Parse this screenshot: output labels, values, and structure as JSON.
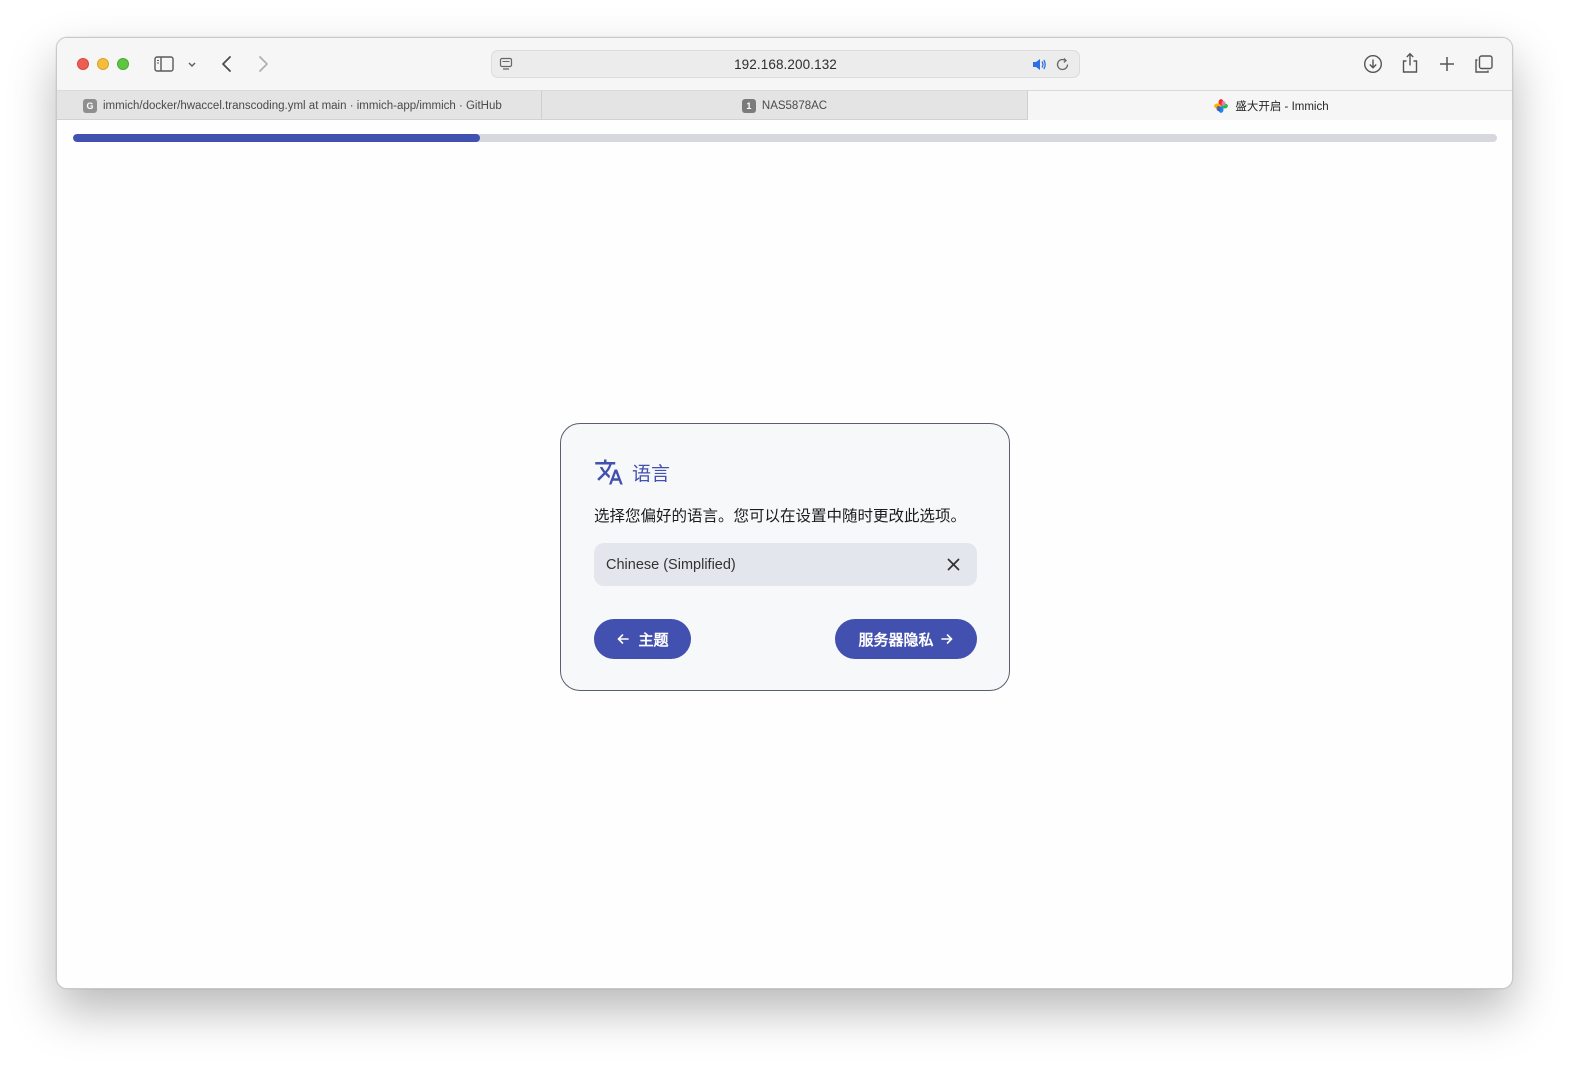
{
  "browser": {
    "address": "192.168.200.132",
    "tabs": [
      {
        "label": "immich/docker/hwaccel.transcoding.yml at main · immich-app/immich · GitHub",
        "favicon": "G"
      },
      {
        "label": "NAS5878AC",
        "favicon": "1"
      },
      {
        "label": "盛大开启 - Immich",
        "favicon": "immich-logo"
      }
    ]
  },
  "progress": {
    "fraction": 0.286,
    "color": "#4250af"
  },
  "card": {
    "title": "语言",
    "description": "选择您偏好的语言。您可以在设置中随时更改此选项。",
    "language_value": "Chinese (Simplified)",
    "back_label": "主题",
    "next_label": "服务器隐私"
  },
  "colors": {
    "accent": "#4250af"
  }
}
